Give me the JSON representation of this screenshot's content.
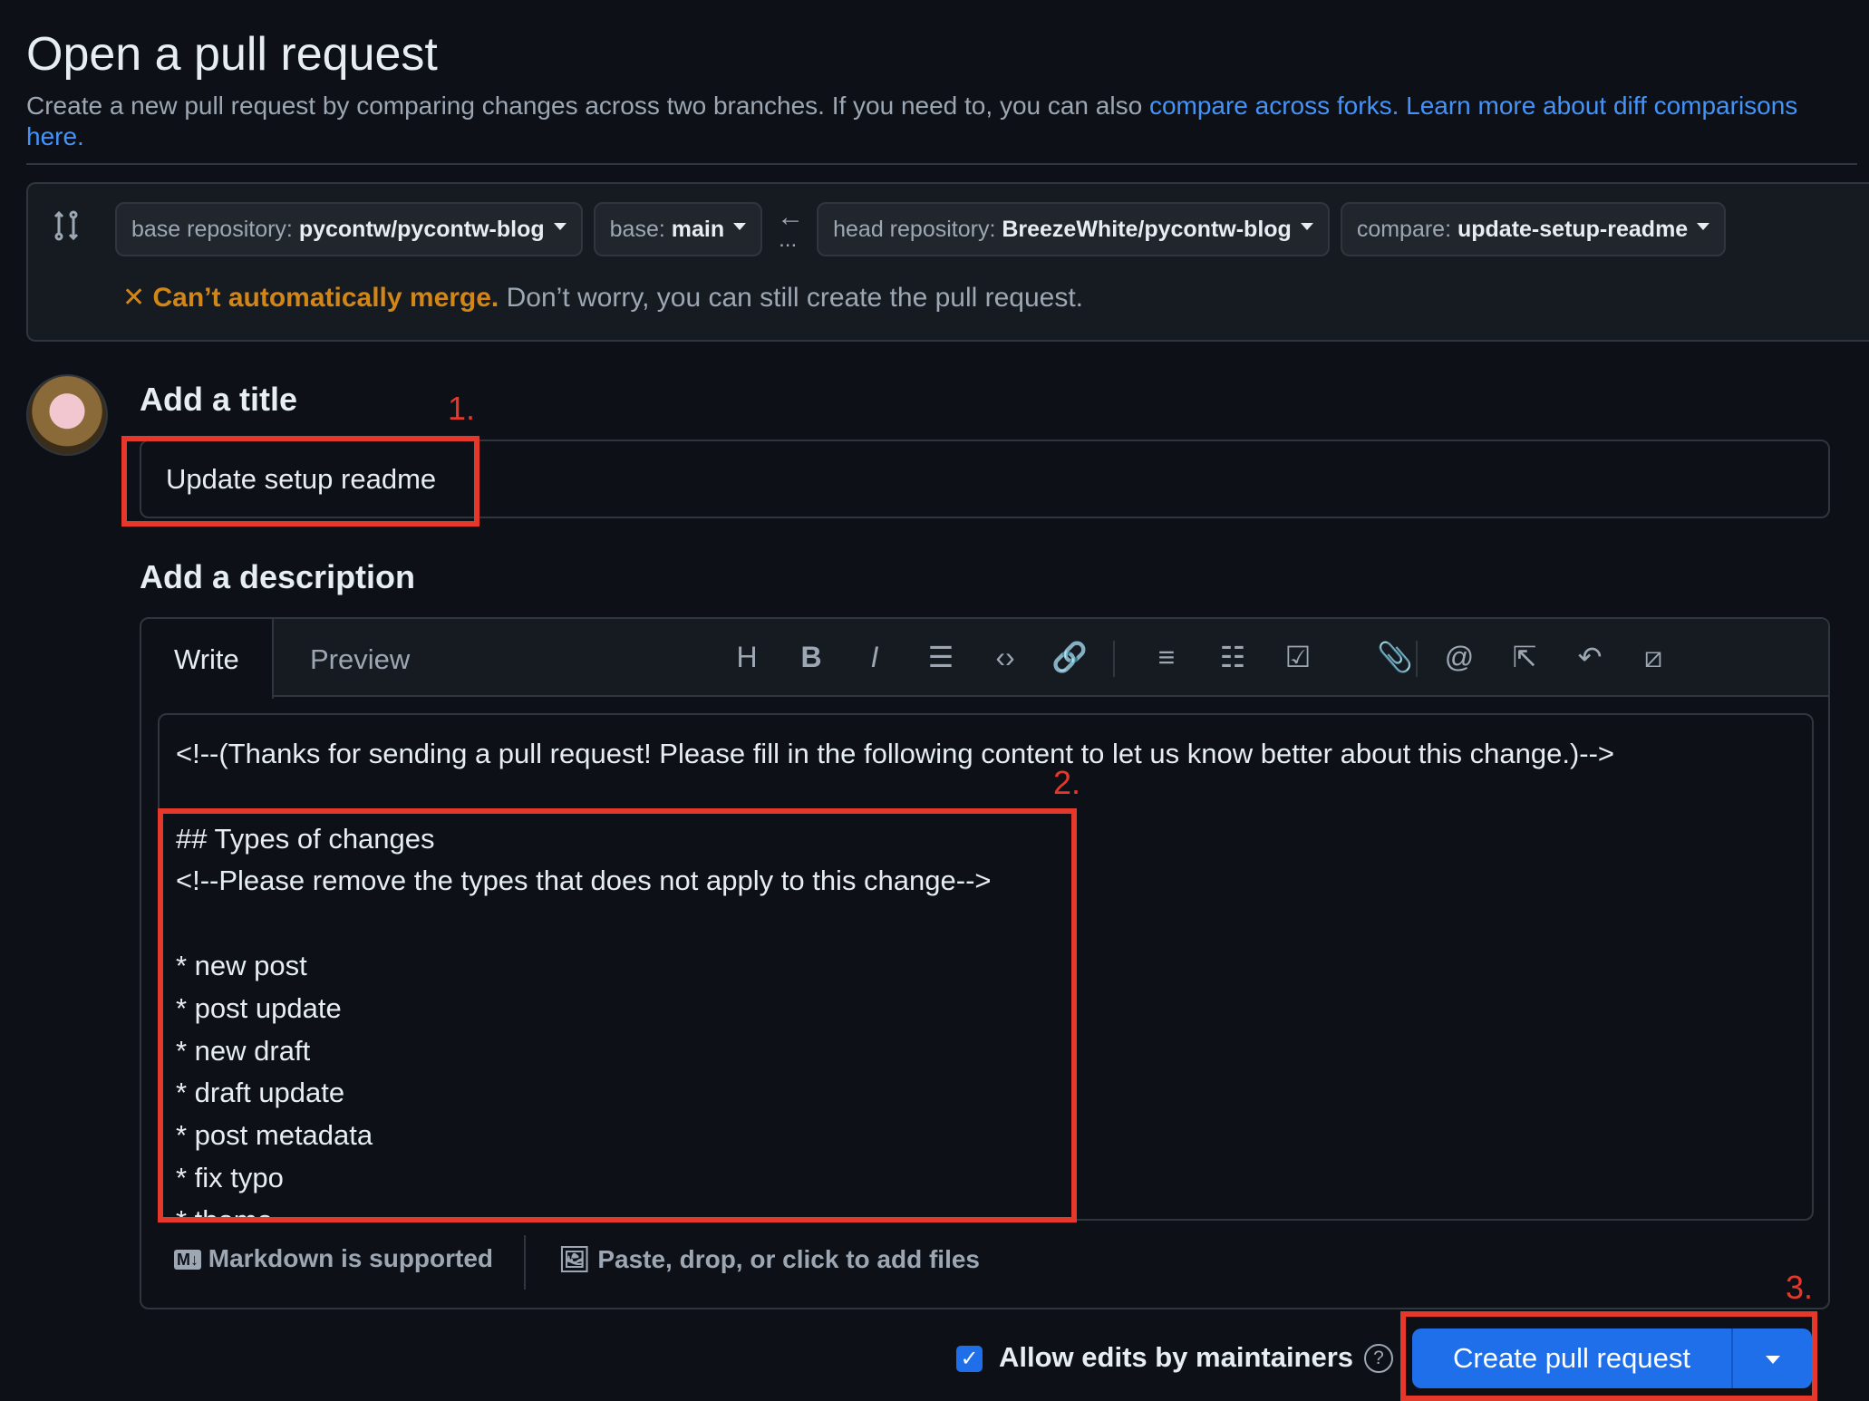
{
  "page": {
    "title": "Open a pull request",
    "subtitle": "Create a new pull request by comparing changes across two branches. If you need to, you can also ",
    "compare_link": "compare across forks.",
    "learn_link": " Learn more about diff comparisons here."
  },
  "compare": {
    "base_repo_label": "base repository: ",
    "base_repo": "pycontw/pycontw-blog",
    "base_label": "base: ",
    "base": "main",
    "head_repo_label": "head repository: ",
    "head_repo": "BreezeWhite/pycontw-blog",
    "compare_label": "compare: ",
    "compare": "update-setup-readme",
    "arrow": "←",
    "dots": "...",
    "warning_icon": "✕",
    "warning_bold": "Can’t automatically merge.",
    "warning_text": " Don’t worry, you can still create the pull request."
  },
  "form": {
    "title_label": "Add a title",
    "title_value": "Update setup readme",
    "desc_label": "Add a description",
    "tabs": [
      "Write",
      "Preview"
    ],
    "toolbar": [
      {
        "icon": "heading-icon",
        "glyph": "H"
      },
      {
        "icon": "bold-icon",
        "glyph": "B"
      },
      {
        "icon": "italic-icon",
        "glyph": "I"
      },
      {
        "icon": "quote-icon",
        "glyph": "☰"
      },
      {
        "icon": "code-icon",
        "glyph": "‹›"
      },
      {
        "icon": "link-icon",
        "glyph": "🔗"
      },
      {
        "icon": "ordered-list-icon",
        "glyph": "≡"
      },
      {
        "icon": "unordered-list-icon",
        "glyph": "☷"
      },
      {
        "icon": "task-list-icon",
        "glyph": "☑"
      },
      {
        "icon": "attach-icon",
        "glyph": "📎"
      },
      {
        "icon": "mention-icon",
        "glyph": "@"
      },
      {
        "icon": "cross-reference-icon",
        "glyph": "⇱"
      },
      {
        "icon": "reply-icon",
        "glyph": "↶"
      },
      {
        "icon": "slash-command-icon",
        "glyph": "⧄"
      }
    ],
    "body": "<!--(Thanks for sending a pull request! Please fill in the following content to let us know better about this change.)-->\n\n## Types of changes\n<!--Please remove the types that does not apply to this change-->\n\n* new post\n* post update\n* new draft\n* draft update\n* post metadata\n* fix typo\n* theme",
    "markdown_icon": "M↓",
    "markdown": "Markdown is supported",
    "files_icon": "🖼",
    "files": "Paste, drop, or click to add files",
    "allow_edits": "Allow edits by maintainers",
    "allow_checked": true,
    "help": "?",
    "create_button": "Create pull request"
  },
  "annotations": [
    "1.",
    "2.",
    "3."
  ],
  "colors": {
    "accent": "#1f6feb",
    "warning": "#d18616",
    "annotation": "#e5372a"
  }
}
